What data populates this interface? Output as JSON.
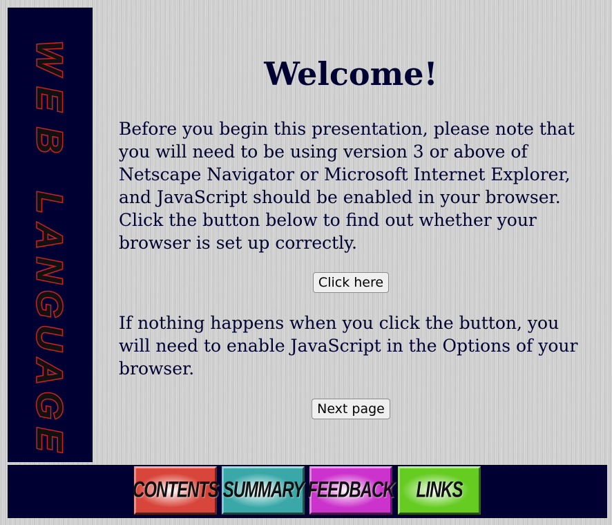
{
  "sidebar": {
    "logo_word1": "WEB",
    "logo_word2": "LANGUAGE"
  },
  "main": {
    "title": "Welcome!",
    "paragraph1": "Before you begin this presentation, please note that you will need to be using version 3 or above of Netscape Navigator or Microsoft Internet Explorer, and JavaScript should be enabled in your browser. Click the button below to find out whether your browser is set up correctly.",
    "check_button_label": "Click here",
    "paragraph2": "If nothing happens when you click the button, you will need to enable JavaScript in the Options of your browser.",
    "next_button_label": "Next page"
  },
  "navbar": {
    "items": [
      {
        "label": "CONTENTS",
        "color": "#d8453a"
      },
      {
        "label": "SUMMARY",
        "color": "#3aa8a8"
      },
      {
        "label": "FEEDBACK",
        "color": "#cc33cc"
      },
      {
        "label": "LINKS",
        "color": "#66cc22"
      }
    ]
  },
  "colors": {
    "panel_bg": "#000033",
    "text": "#000033",
    "logo_red": "#cc2222"
  }
}
